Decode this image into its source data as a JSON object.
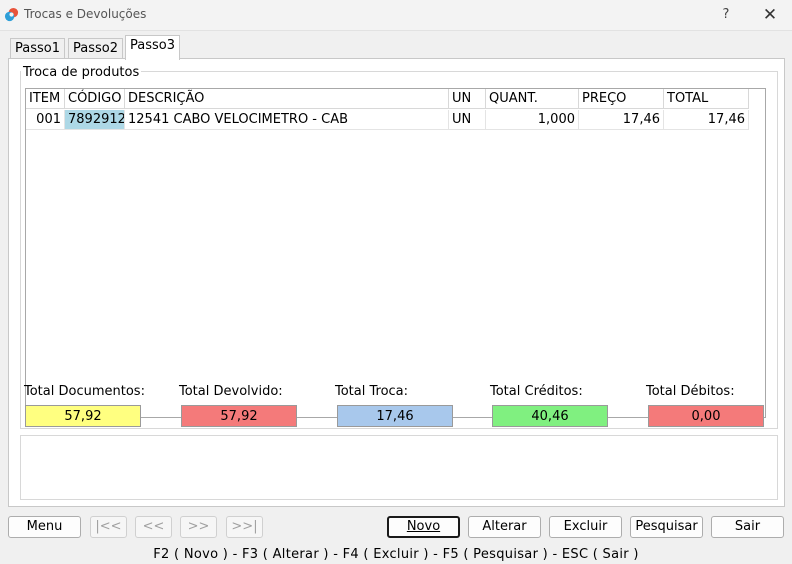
{
  "window": {
    "title": "Trocas e Devoluções",
    "help_label": "?",
    "close_label": "✕"
  },
  "tabs": [
    "Passo1",
    "Passo2",
    "Passo3"
  ],
  "group": {
    "label": "Troca de produtos"
  },
  "grid": {
    "columns": [
      "ITEM",
      "CÓDIGO",
      "DESCRIÇÃO",
      "UN",
      "QUANT.",
      "PREÇO",
      "TOTAL"
    ],
    "rows": [
      {
        "item": "001",
        "codigo": "7892912",
        "descricao": "12541 CABO VELOCIMETRO - CAB",
        "un": "UN",
        "quant": "1,000",
        "preco": "17,46",
        "total": "17,46"
      }
    ]
  },
  "totals": [
    {
      "label": "Total Documentos:",
      "value": "57,92",
      "color": "#ffff80"
    },
    {
      "label": "Total Devolvido:",
      "value": "57,92",
      "color": "#f47a7a"
    },
    {
      "label": "Total Troca:",
      "value": "17,46",
      "color": "#a8c8ec"
    },
    {
      "label": "Total Créditos:",
      "value": "40,46",
      "color": "#80f080"
    },
    {
      "label": "Total Débitos:",
      "value": "0,00",
      "color": "#f47a7a"
    }
  ],
  "buttons": {
    "menu": "Menu",
    "first": "|<<",
    "prev": "<<",
    "next": ">>",
    "last": ">>|",
    "novo": "Novo",
    "alterar": "Alterar",
    "excluir": "Excluir",
    "pesquisar": "Pesquisar",
    "sair": "Sair"
  },
  "shortcuts": "F2 ( Novo )  -  F3 ( Alterar )  -  F4 ( Excluir )  -  F5 ( Pesquisar )  -  ESC ( Sair )"
}
